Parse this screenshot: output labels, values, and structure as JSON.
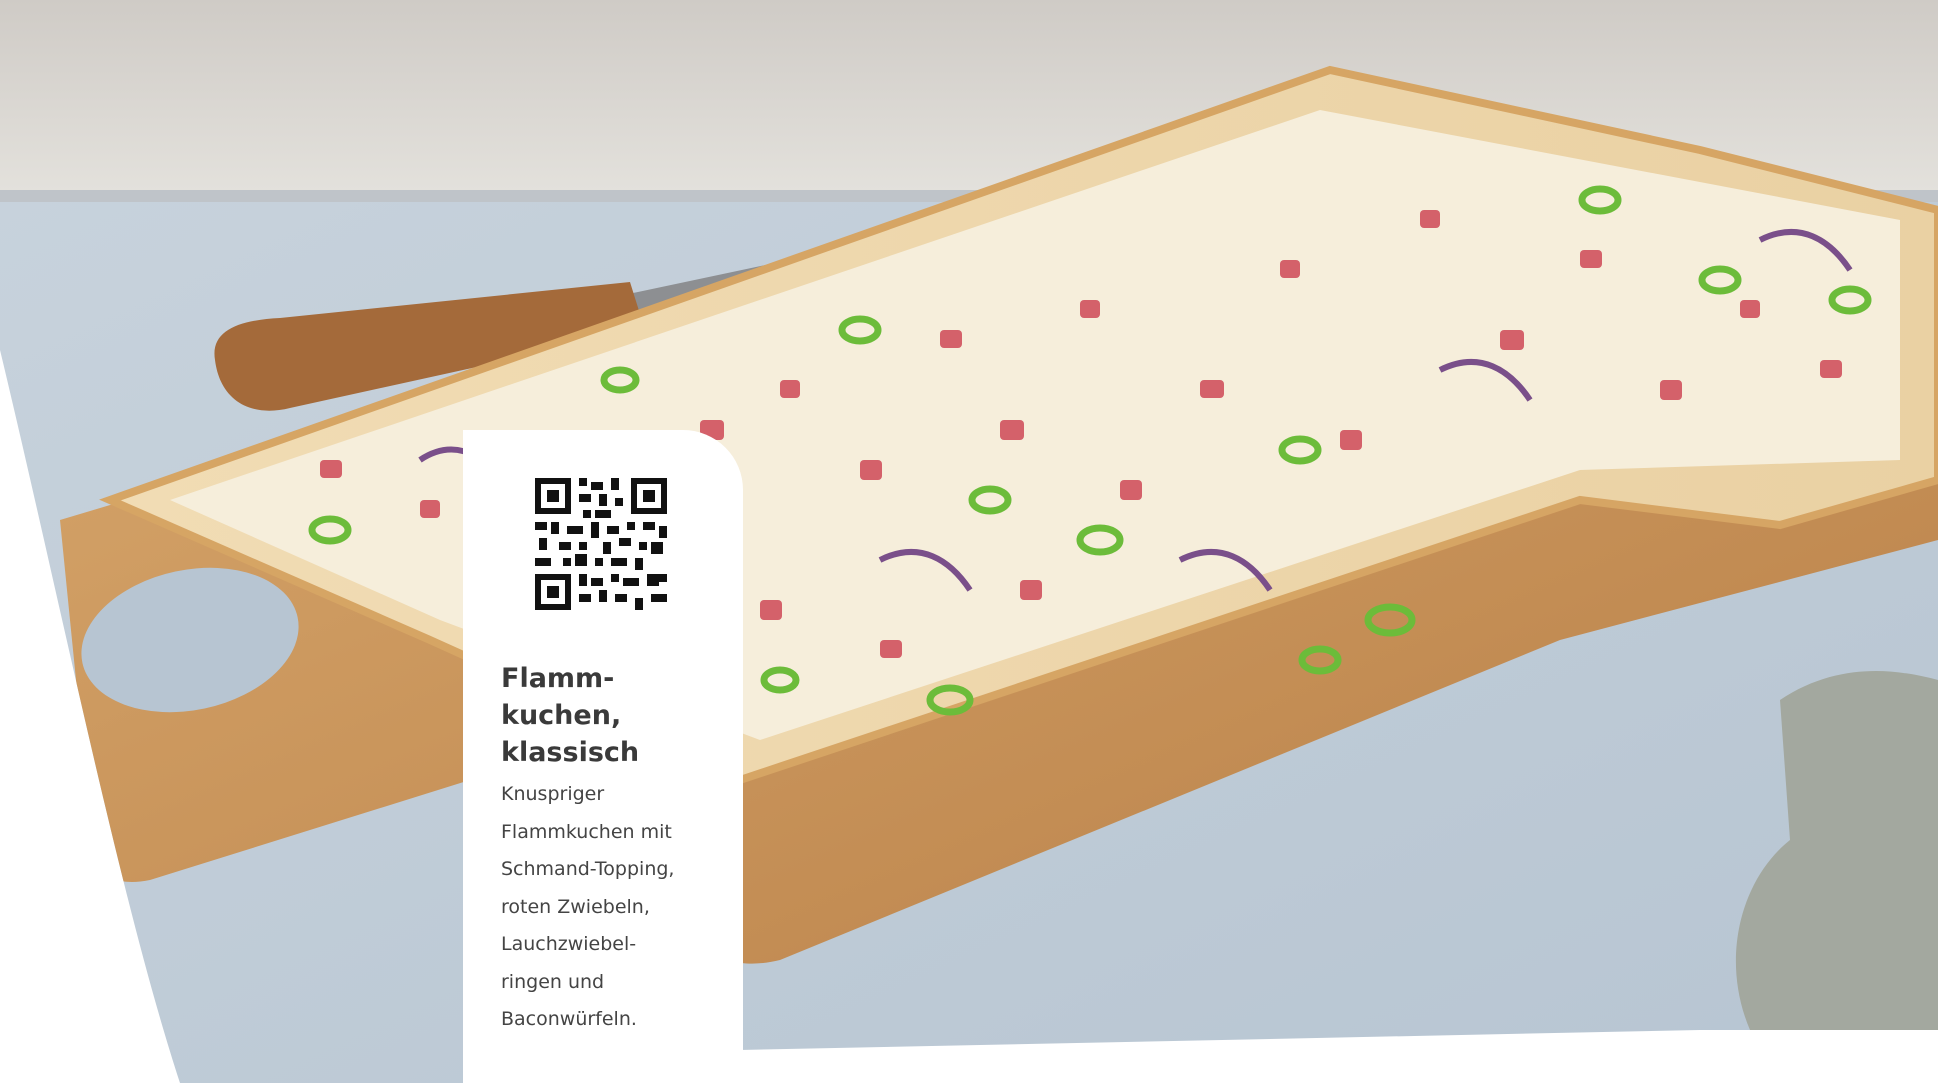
{
  "product": {
    "title_lines": [
      "Flamm-",
      "kuchen,",
      "klassisch"
    ],
    "description_lines": [
      "Knuspriger",
      "Flammkuchen mit",
      "Schmand-Topping,",
      "roten Zwiebeln,",
      "Lauchzwiebel-",
      "ringen und",
      "Baconwürfeln."
    ]
  },
  "photo": {
    "subject": "flammkuchen-on-wooden-board"
  }
}
